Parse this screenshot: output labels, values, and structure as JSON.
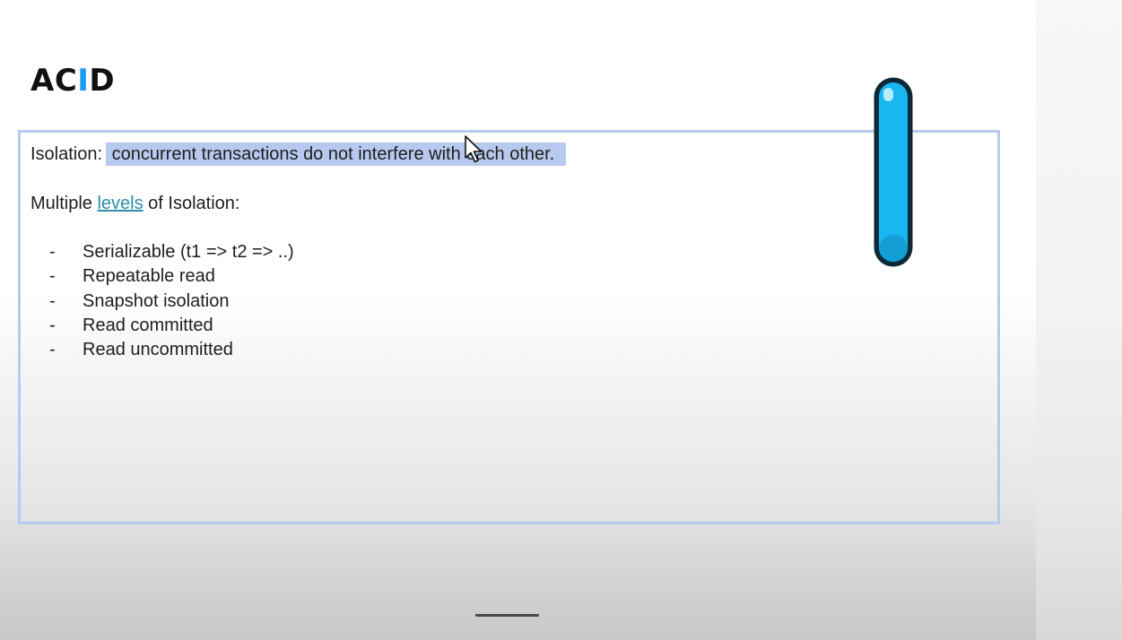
{
  "slide": {
    "title_prefix": "AC",
    "title_accent": "I",
    "title_suffix": "D",
    "definition_label": "Isolation:",
    "definition_text": "concurrent transactions do not interfere with each other.",
    "levels_intro_before": "Multiple ",
    "levels_link": "levels",
    "levels_intro_after": " of Isolation:",
    "bullet": "-",
    "levels": [
      "Serializable (t1 => t2 => ..)",
      "Repeatable read",
      "Snapshot isolation",
      "Read committed",
      "Read uncommitted"
    ]
  },
  "icons": {
    "cursor": "arrow-cursor-icon",
    "pill": "vertical-pill-icon"
  },
  "colors": {
    "accent": "#1a9cf2",
    "highlight": "#b7c9ee",
    "frame_border": "#b9c9ef",
    "link": "#2b8ea6",
    "pill_fill": "#19b6f2",
    "pill_outline": "#0c2a36"
  }
}
